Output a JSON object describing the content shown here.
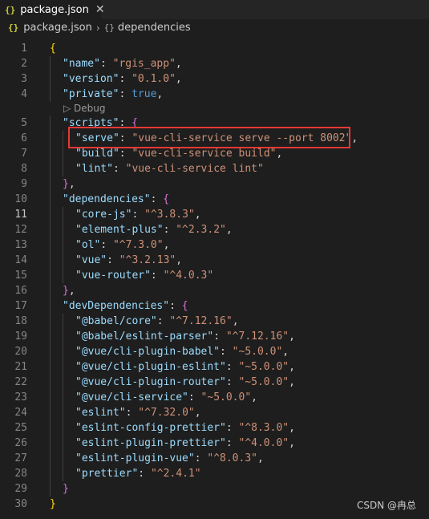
{
  "tab": {
    "icon": "{}",
    "title": "package.json",
    "close": "✕"
  },
  "breadcrumb": {
    "icon": "{}",
    "file": "package.json",
    "separator": "›",
    "symbol_icon": "{}",
    "symbol": "dependencies"
  },
  "codelens": {
    "label": "Debug",
    "icon": "play-icon"
  },
  "lines": [
    {
      "n": "1",
      "t": [
        [
          "br1",
          "{"
        ]
      ]
    },
    {
      "n": "2",
      "t": [
        [
          "k",
          "\"name\""
        ],
        [
          "p",
          ": "
        ],
        [
          "s",
          "\"rgis_app\""
        ],
        [
          "p",
          ","
        ]
      ]
    },
    {
      "n": "3",
      "t": [
        [
          "k",
          "\"version\""
        ],
        [
          "p",
          ": "
        ],
        [
          "s",
          "\"0.1.0\""
        ],
        [
          "p",
          ","
        ]
      ]
    },
    {
      "n": "4",
      "t": [
        [
          "k",
          "\"private\""
        ],
        [
          "p",
          ": "
        ],
        [
          "b",
          "true"
        ],
        [
          "p",
          ","
        ]
      ]
    },
    {
      "n": "5",
      "t": [
        [
          "k",
          "\"scripts\""
        ],
        [
          "p",
          ": "
        ],
        [
          "br2",
          "{"
        ]
      ]
    },
    {
      "n": "6",
      "t": [
        [
          "k",
          "\"serve\""
        ],
        [
          "p",
          ": "
        ],
        [
          "s",
          "\"vue-cli-service serve --port 8002\""
        ],
        [
          "p",
          ","
        ]
      ]
    },
    {
      "n": "7",
      "t": [
        [
          "k",
          "\"build\""
        ],
        [
          "p",
          ": "
        ],
        [
          "s",
          "\"vue-cli-service build\""
        ],
        [
          "p",
          ","
        ]
      ]
    },
    {
      "n": "8",
      "t": [
        [
          "k",
          "\"lint\""
        ],
        [
          "p",
          ": "
        ],
        [
          "s",
          "\"vue-cli-service lint\""
        ]
      ]
    },
    {
      "n": "9",
      "t": [
        [
          "br2",
          "}"
        ],
        [
          "p",
          ","
        ]
      ]
    },
    {
      "n": "10",
      "t": [
        [
          "k",
          "\"dependencies\""
        ],
        [
          "p",
          ": "
        ],
        [
          "br2",
          "{"
        ]
      ]
    },
    {
      "n": "11",
      "t": [
        [
          "k",
          "\"core-js\""
        ],
        [
          "p",
          ": "
        ],
        [
          "s",
          "\"^3.8.3\""
        ],
        [
          "p",
          ","
        ]
      ]
    },
    {
      "n": "12",
      "t": [
        [
          "k",
          "\"element-plus\""
        ],
        [
          "p",
          ": "
        ],
        [
          "s",
          "\"^2.3.2\""
        ],
        [
          "p",
          ","
        ]
      ]
    },
    {
      "n": "13",
      "t": [
        [
          "k",
          "\"ol\""
        ],
        [
          "p",
          ": "
        ],
        [
          "s",
          "\"^7.3.0\""
        ],
        [
          "p",
          ","
        ]
      ]
    },
    {
      "n": "14",
      "t": [
        [
          "k",
          "\"vue\""
        ],
        [
          "p",
          ": "
        ],
        [
          "s",
          "\"^3.2.13\""
        ],
        [
          "p",
          ","
        ]
      ]
    },
    {
      "n": "15",
      "t": [
        [
          "k",
          "\"vue-router\""
        ],
        [
          "p",
          ": "
        ],
        [
          "s",
          "\"^4.0.3\""
        ]
      ]
    },
    {
      "n": "16",
      "t": [
        [
          "br2",
          "}"
        ],
        [
          "p",
          ","
        ]
      ]
    },
    {
      "n": "17",
      "t": [
        [
          "k",
          "\"devDependencies\""
        ],
        [
          "p",
          ": "
        ],
        [
          "br2",
          "{"
        ]
      ]
    },
    {
      "n": "18",
      "t": [
        [
          "k",
          "\"@babel/core\""
        ],
        [
          "p",
          ": "
        ],
        [
          "s",
          "\"^7.12.16\""
        ],
        [
          "p",
          ","
        ]
      ]
    },
    {
      "n": "19",
      "t": [
        [
          "k",
          "\"@babel/eslint-parser\""
        ],
        [
          "p",
          ": "
        ],
        [
          "s",
          "\"^7.12.16\""
        ],
        [
          "p",
          ","
        ]
      ]
    },
    {
      "n": "20",
      "t": [
        [
          "k",
          "\"@vue/cli-plugin-babel\""
        ],
        [
          "p",
          ": "
        ],
        [
          "s",
          "\"~5.0.0\""
        ],
        [
          "p",
          ","
        ]
      ]
    },
    {
      "n": "21",
      "t": [
        [
          "k",
          "\"@vue/cli-plugin-eslint\""
        ],
        [
          "p",
          ": "
        ],
        [
          "s",
          "\"~5.0.0\""
        ],
        [
          "p",
          ","
        ]
      ]
    },
    {
      "n": "22",
      "t": [
        [
          "k",
          "\"@vue/cli-plugin-router\""
        ],
        [
          "p",
          ": "
        ],
        [
          "s",
          "\"~5.0.0\""
        ],
        [
          "p",
          ","
        ]
      ]
    },
    {
      "n": "23",
      "t": [
        [
          "k",
          "\"@vue/cli-service\""
        ],
        [
          "p",
          ": "
        ],
        [
          "s",
          "\"~5.0.0\""
        ],
        [
          "p",
          ","
        ]
      ]
    },
    {
      "n": "24",
      "t": [
        [
          "k",
          "\"eslint\""
        ],
        [
          "p",
          ": "
        ],
        [
          "s",
          "\"^7.32.0\""
        ],
        [
          "p",
          ","
        ]
      ]
    },
    {
      "n": "25",
      "t": [
        [
          "k",
          "\"eslint-config-prettier\""
        ],
        [
          "p",
          ": "
        ],
        [
          "s",
          "\"^8.3.0\""
        ],
        [
          "p",
          ","
        ]
      ]
    },
    {
      "n": "26",
      "t": [
        [
          "k",
          "\"eslint-plugin-prettier\""
        ],
        [
          "p",
          ": "
        ],
        [
          "s",
          "\"^4.0.0\""
        ],
        [
          "p",
          ","
        ]
      ]
    },
    {
      "n": "27",
      "t": [
        [
          "k",
          "\"eslint-plugin-vue\""
        ],
        [
          "p",
          ": "
        ],
        [
          "s",
          "\"^8.0.3\""
        ],
        [
          "p",
          ","
        ]
      ]
    },
    {
      "n": "28",
      "t": [
        [
          "k",
          "\"prettier\""
        ],
        [
          "p",
          ": "
        ],
        [
          "s",
          "\"^2.4.1\""
        ]
      ]
    },
    {
      "n": "29",
      "t": [
        [
          "br2",
          "}"
        ]
      ]
    },
    {
      "n": "30",
      "t": [
        [
          "br1",
          "}"
        ]
      ]
    }
  ],
  "active_line": "11",
  "colors": {
    "key": "#9cdcfe",
    "string": "#ce9178",
    "boolean": "#569cd6",
    "bracket1": "#ffd700",
    "bracket2": "#da70d6",
    "highlight": "#e53935"
  },
  "watermark": "CSDN @冉总"
}
